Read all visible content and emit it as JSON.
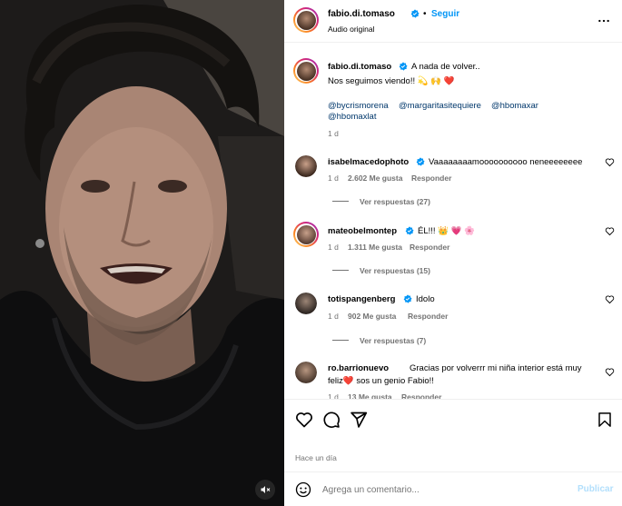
{
  "post": {
    "username": "fabio.di.tomaso",
    "follow_label": "Seguir",
    "separator": "•",
    "audio": "Audio original",
    "caption_line1": "A nada de volver..",
    "caption_line2": "Nos seguimos viendo!! 💫 🙌 ❤️",
    "mention_1": "@bycrismorena",
    "mention_2": "@margaritasitequiere",
    "mention_3": "@hbomaxar",
    "mention_4": "@hbomaxlat",
    "caption_time": "1 d"
  },
  "comments": [
    {
      "username": "isabelmacedophoto",
      "text": "Vaaaaaaaamoooooooooo neneeeeeeee",
      "time": "1 d",
      "likes": "2.602 Me gusta",
      "reply": "Responder",
      "view_replies": "Ver respuestas (27)"
    },
    {
      "username": "mateobelmontep",
      "text": "ÉL!!! 👑 💗 🌸",
      "time": "1 d",
      "likes": "1.311 Me gusta",
      "reply": "Responder",
      "view_replies": "Ver respuestas (15)"
    },
    {
      "username": "totispangenberg",
      "text": "Idolo",
      "time": "1 d",
      "likes": "902 Me gusta",
      "reply": "Responder",
      "view_replies": "Ver respuestas (7)"
    },
    {
      "username": "ro.barrionuevo",
      "text_line1": "Gracias por volverrr mi niña interior está muy",
      "text_line2": "feliz❤️ sos un genio Fabio!!",
      "time": "1 d",
      "likes": "13 Me gusta",
      "reply": "Responder"
    }
  ],
  "timestamp": "Hace un día",
  "composer": {
    "placeholder": "Agrega un comentario...",
    "publish_label": "Publicar"
  },
  "icons": {
    "more": "more-options-icon",
    "like": "heart-icon",
    "comment": "comment-icon",
    "share": "share-icon",
    "save": "bookmark-icon",
    "emoji": "emoji-icon",
    "mute": "mute-icon",
    "verified": "verified-badge-icon"
  },
  "colors": {
    "accent": "#0095f6",
    "link": "#00376b",
    "muted": "#737373",
    "verified": "#0095f6"
  }
}
